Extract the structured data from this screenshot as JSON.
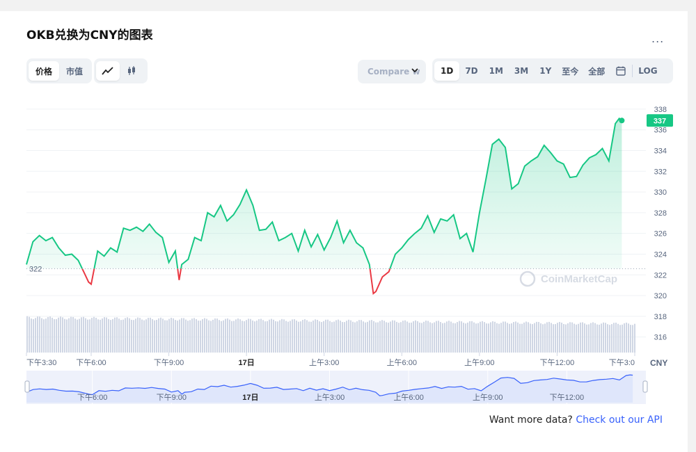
{
  "title": "OKB兑换为CNY的图表",
  "more_label": "...",
  "toggle_metric": [
    "价格",
    "市值"
  ],
  "toggle_type_icons": [
    "line-chart-icon",
    "candlestick-icon"
  ],
  "compare_label": "Compare w",
  "ranges": [
    "1D",
    "7D",
    "1M",
    "3M",
    "1Y",
    "至今",
    "全部"
  ],
  "range_active": "1D",
  "calendar_icon": "calendar-icon",
  "log_label": "LOG",
  "watermark": "CoinMarketCap",
  "currency_label": "CNY",
  "current_price_label": "337",
  "baseline_label": "322",
  "footer": {
    "text": "Want more data? ",
    "link": "Check out our API"
  },
  "colors": {
    "up": "#16c784",
    "down": "#ea3943",
    "accent": "#3861fb"
  },
  "chart_data": {
    "type": "line",
    "ylim": [
      314.5,
      339
    ],
    "yticks": [
      338,
      336,
      334,
      332,
      330,
      328,
      326,
      324,
      322,
      320,
      318,
      316
    ],
    "baseline": 322.6,
    "x_tick_labels": [
      "下午3:30",
      "下午6:00",
      "下午9:00",
      "17日",
      "上午3:00",
      "上午6:00",
      "上午9:00",
      "下午12:00",
      "下午3:0"
    ],
    "x_tick_positions": [
      0,
      2.5,
      5.5,
      8.5,
      11.5,
      14.5,
      17.5,
      20.5,
      23.5
    ],
    "x_max": 23.5,
    "series": [
      {
        "points": [
          [
            0,
            323
          ],
          [
            0.25,
            325.2
          ],
          [
            0.5,
            325.8
          ],
          [
            0.75,
            325.3
          ],
          [
            1,
            325.6
          ],
          [
            1.25,
            324.6
          ],
          [
            1.5,
            323.9
          ],
          [
            1.75,
            324
          ],
          [
            2,
            323.4
          ],
          [
            2.25,
            322.1
          ],
          [
            2.4,
            321.3
          ],
          [
            2.5,
            321.1
          ],
          [
            2.75,
            324.3
          ],
          [
            3,
            323.8
          ],
          [
            3.25,
            324.6
          ],
          [
            3.5,
            324.2
          ],
          [
            3.75,
            326.5
          ],
          [
            4,
            326.3
          ],
          [
            4.25,
            326.6
          ],
          [
            4.5,
            326.2
          ],
          [
            4.75,
            326.9
          ],
          [
            5,
            326.1
          ],
          [
            5.25,
            325.6
          ],
          [
            5.5,
            323.2
          ],
          [
            5.75,
            324.3
          ],
          [
            5.9,
            321.5
          ],
          [
            6,
            323
          ],
          [
            6.25,
            323.5
          ],
          [
            6.5,
            325.6
          ],
          [
            6.75,
            325.3
          ],
          [
            7,
            328
          ],
          [
            7.25,
            327.6
          ],
          [
            7.5,
            328.7
          ],
          [
            7.75,
            327.2
          ],
          [
            8,
            327.8
          ],
          [
            8.25,
            328.8
          ],
          [
            8.5,
            330.2
          ],
          [
            8.75,
            328.7
          ],
          [
            9,
            326.3
          ],
          [
            9.25,
            326.4
          ],
          [
            9.5,
            327.1
          ],
          [
            9.75,
            325.3
          ],
          [
            10,
            325.6
          ],
          [
            10.25,
            326
          ],
          [
            10.5,
            324.3
          ],
          [
            10.75,
            326.3
          ],
          [
            11,
            324.7
          ],
          [
            11.25,
            325.9
          ],
          [
            11.5,
            324.4
          ],
          [
            11.75,
            325.6
          ],
          [
            12,
            327.2
          ],
          [
            12.25,
            325.1
          ],
          [
            12.5,
            326.3
          ],
          [
            12.75,
            325.1
          ],
          [
            13,
            324.6
          ],
          [
            13.25,
            323
          ],
          [
            13.4,
            320.2
          ],
          [
            13.5,
            320.4
          ],
          [
            13.75,
            321.8
          ],
          [
            14,
            322.3
          ],
          [
            14.25,
            324
          ],
          [
            14.5,
            324.6
          ],
          [
            14.75,
            325.4
          ],
          [
            15,
            326
          ],
          [
            15.25,
            326.5
          ],
          [
            15.5,
            327.7
          ],
          [
            15.75,
            326.1
          ],
          [
            16,
            327.4
          ],
          [
            16.25,
            327.2
          ],
          [
            16.5,
            327.8
          ],
          [
            16.75,
            325.5
          ],
          [
            17,
            326
          ],
          [
            17.25,
            324.2
          ],
          [
            17.5,
            328
          ],
          [
            17.75,
            331.2
          ],
          [
            18,
            334.6
          ],
          [
            18.25,
            335.1
          ],
          [
            18.5,
            334.3
          ],
          [
            18.75,
            330.3
          ],
          [
            19,
            330.8
          ],
          [
            19.25,
            332.5
          ],
          [
            19.5,
            333
          ],
          [
            19.75,
            333.4
          ],
          [
            20,
            334.5
          ],
          [
            20.25,
            333.8
          ],
          [
            20.5,
            333
          ],
          [
            20.75,
            332.7
          ],
          [
            21,
            331.4
          ],
          [
            21.25,
            331.5
          ],
          [
            21.5,
            332.6
          ],
          [
            21.75,
            333.3
          ],
          [
            22,
            333.6
          ],
          [
            22.25,
            334.2
          ],
          [
            22.5,
            333
          ],
          [
            22.75,
            336.6
          ],
          [
            22.9,
            337.1
          ],
          [
            23,
            336.9
          ]
        ]
      }
    ],
    "volume_level": 0.95
  },
  "navigator": {
    "x_tick_labels": [
      "下午6:00",
      "下午9:00",
      "17日",
      "上午3:00",
      "上午6:00",
      "上午9:00",
      "下午12:00"
    ]
  }
}
